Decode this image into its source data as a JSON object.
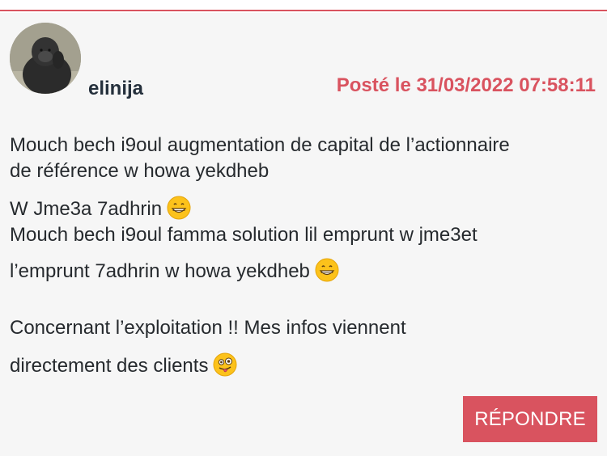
{
  "colors": {
    "accent": "#d9535f",
    "text": "#262a2e",
    "username": "#25303c",
    "card_bg": "#f6f6f6"
  },
  "post": {
    "author": "elinija",
    "timestamp": "Posté le 31/03/2022 07:58:11",
    "lines": [
      "Mouch bech i9oul augmentation de capital de l’actionnaire",
      "de référence w howa yekdheb",
      "W Jme3a 7adhrin",
      "Mouch bech i9oul famma solution lil emprunt w jme3et",
      "l’emprunt 7adhrin w howa yekdheb",
      "Concernant l’exploitation !! Mes infos viennent",
      "directement des clients"
    ],
    "emojis": [
      "grinning-face-emoji",
      "grinning-face-emoji",
      "winking-tongue-face-emoji"
    ]
  },
  "actions": {
    "reply_label": "RÉPONDRE"
  }
}
